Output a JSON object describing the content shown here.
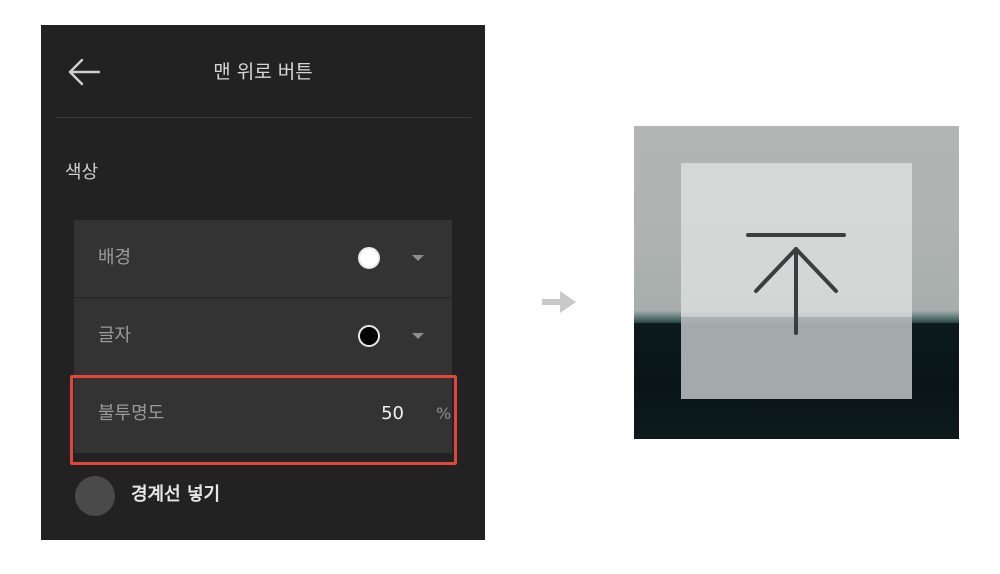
{
  "panel": {
    "title": "맨 위로 버튼",
    "back_icon": "arrow-left-icon",
    "section_label": "색상",
    "options": [
      {
        "label": "배경",
        "swatch_color": "#ffffff",
        "caret_icon": "caret-down-icon"
      },
      {
        "label": "글자",
        "swatch_color": "#000000",
        "caret_icon": "caret-down-icon"
      }
    ],
    "opacity": {
      "label": "불투명도",
      "value": "50",
      "unit": "%"
    },
    "border_toggle": {
      "label": "경계선 넣기"
    }
  },
  "transition_icon": "arrow-right-icon",
  "preview": {
    "icon": "arrow-up-to-top-icon"
  },
  "colors": {
    "panel_bg": "#222222",
    "group_bg": "#333333",
    "highlight": "#e0463a",
    "toggle_off": "#4a4a4a"
  }
}
